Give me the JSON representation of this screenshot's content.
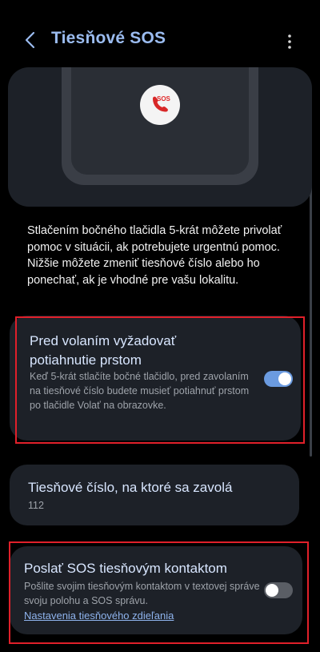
{
  "header": {
    "title": "Tiesňové SOS"
  },
  "illustration": {
    "badge_text": "SOS"
  },
  "description": "Stlačením bočného tlačidla 5-krát môžete privolať pomoc v situácii, ak potrebujete urgentnú pomoc. Nižšie môžete zmeniť tiesňové číslo alebo ho ponechať, ak je vhodné pre vašu lokalitu.",
  "settings": {
    "swipe": {
      "title": "Pred volaním vyžadovať potiahnutie prstom",
      "subtitle": "Keď 5-krát stlačíte bočné tlačidlo, pred zavolaním na tiesňové číslo budete musieť potiahnuť prstom po tlačidle Volať na obrazovke.",
      "enabled": true
    },
    "emergency_number": {
      "title": "Tiesňové číslo, na ktoré sa zavolá",
      "value": "112"
    },
    "send_sos": {
      "title": "Poslať SOS tiesňovým kontaktom",
      "subtitle": "Pošlite svojim tiesňovým kontaktom v textovej správe svoju polohu a SOS správu.",
      "link": "Nastavenia tiesňového zdieľania",
      "enabled": false
    }
  },
  "colors": {
    "title_accent": "#9bbcf0",
    "highlight": "#e0202a",
    "toggle_on": "#6b9be0"
  },
  "icons": [
    "back-arrow-icon",
    "more-vert-icon",
    "sos-phone-icon"
  ]
}
